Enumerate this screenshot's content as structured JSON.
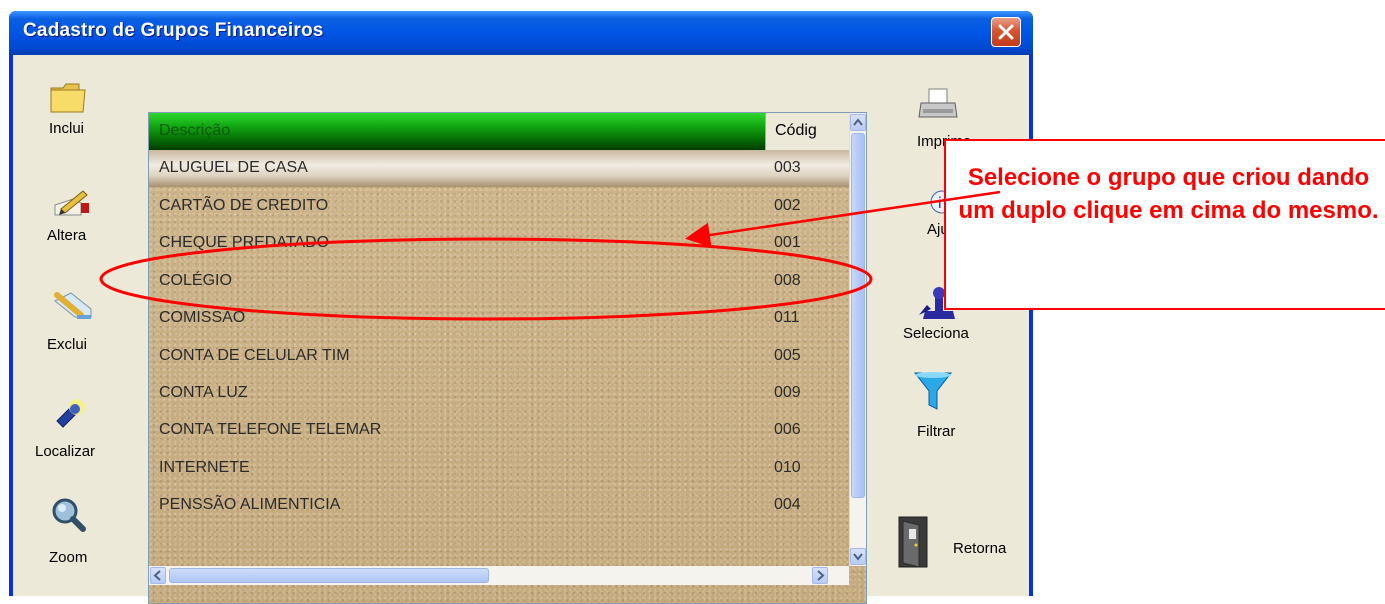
{
  "window": {
    "title": "Cadastro de Grupos Financeiros"
  },
  "left_buttons": {
    "inclui": "Inclui",
    "altera": "Altera",
    "exclui": "Exclui",
    "localizar": "Localizar",
    "zoom": "Zoom"
  },
  "right_buttons": {
    "imprime": "Imprime",
    "ajuda": "Ajuda",
    "seleciona": "Seleciona",
    "filtrar": "Filtrar",
    "retorna": "Retorna"
  },
  "grid": {
    "columns": [
      "Descrição",
      "Códig"
    ],
    "rows": [
      {
        "descricao": "ALUGUEL DE CASA",
        "codigo": "003"
      },
      {
        "descricao": "CARTÃO DE CREDITO",
        "codigo": "002"
      },
      {
        "descricao": "CHEQUE PREDATADO",
        "codigo": "001"
      },
      {
        "descricao": "COLÉGIO",
        "codigo": "008"
      },
      {
        "descricao": "COMISSÃO",
        "codigo": "011"
      },
      {
        "descricao": "CONTA DE CELULAR TIM",
        "codigo": "005"
      },
      {
        "descricao": "CONTA LUZ",
        "codigo": "009"
      },
      {
        "descricao": "CONTA TELEFONE TELEMAR",
        "codigo": "006"
      },
      {
        "descricao": "INTERNETE",
        "codigo": "010"
      },
      {
        "descricao": "PENSSÃO ALIMENTICIA",
        "codigo": "004"
      }
    ],
    "selected_row": 0
  },
  "annotation": {
    "text": "Selecione o grupo que criou dando um duplo clique em cima do mesmo.",
    "color": "#ff0000"
  },
  "colors": {
    "titlebar": "#0055e5",
    "header_green": "#067006",
    "grid_background": "#c8ae84",
    "annotation": "#ff0000"
  }
}
